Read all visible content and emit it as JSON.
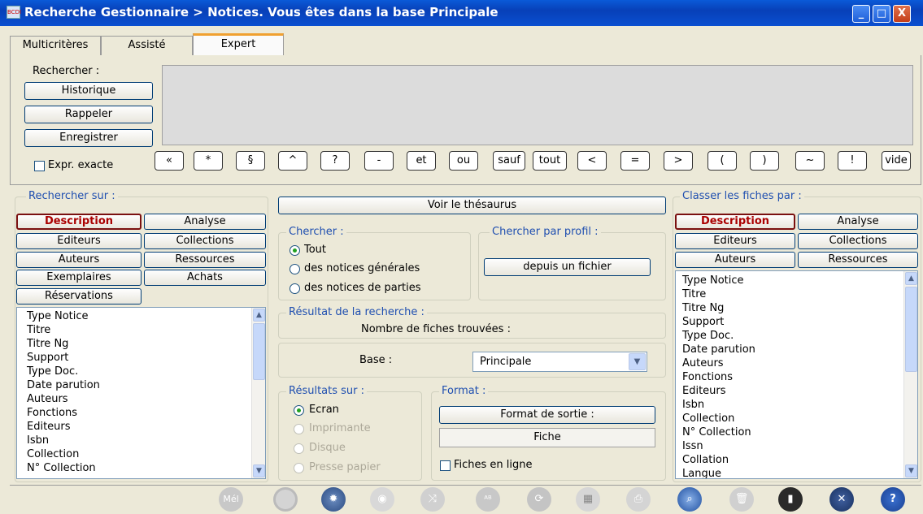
{
  "window": {
    "title": "Recherche Gestionnaire > Notices.  Vous êtes dans la base Principale",
    "icon_text": "BCDI",
    "minimize": "_",
    "maximize": "□",
    "close": "X"
  },
  "tabs": [
    {
      "label": "Multicritères"
    },
    {
      "label": "Assisté"
    },
    {
      "label": "Expert"
    }
  ],
  "expert": {
    "rechercher_label": "Rechercher :",
    "historique": "Historique",
    "rappeler": "Rappeler",
    "enregistrer": "Enregistrer",
    "expr_exacte": "Expr. exacte",
    "query_value": "",
    "symbols": [
      "«",
      "*",
      "§",
      "^",
      "?",
      "-",
      "et",
      "ou",
      "sauf",
      "tout",
      "<",
      "=",
      ">",
      "(",
      ")",
      "~",
      "!",
      "vide"
    ]
  },
  "rechercher_sur": {
    "label": "Rechercher sur :",
    "buttons": [
      "Description",
      "Analyse",
      "Editeurs",
      "Collections",
      "Auteurs",
      "Ressources",
      "Exemplaires",
      "Achats",
      "Réservations"
    ],
    "fields": [
      "Type Notice",
      "Titre",
      "Titre Ng",
      "Support",
      "Type Doc.",
      "Date parution",
      "Auteurs",
      "Fonctions",
      "Editeurs",
      "Isbn",
      "Collection",
      "N° Collection"
    ]
  },
  "center": {
    "voir_thesaurus": "Voir le thésaurus",
    "chercher_label": "Chercher :",
    "chercher_options": [
      "Tout",
      "des notices générales",
      "des notices de parties"
    ],
    "profil_label": "Chercher par profil :",
    "depuis_fichier": "depuis un fichier",
    "resultat_label": "Résultat de la recherche :",
    "nombre_fiches": "Nombre de fiches trouvées :",
    "base_label": "Base :",
    "base_value": "Principale",
    "resultats_sur_label": "Résultats sur :",
    "resultats_options": [
      "Ecran",
      "Imprimante",
      "Disque",
      "Presse papier"
    ],
    "format_label": "Format :",
    "format_sortie": "Format de sortie :",
    "format_value": "Fiche",
    "fiches_en_ligne": "Fiches en ligne"
  },
  "classer": {
    "label": "Classer les fiches par :",
    "buttons": [
      "Description",
      "Analyse",
      "Editeurs",
      "Collections",
      "Auteurs",
      "Ressources"
    ],
    "fields": [
      "Type Notice",
      "Titre",
      "Titre Ng",
      "Support",
      "Type Doc.",
      "Date parution",
      "Auteurs",
      "Fonctions",
      "Editeurs",
      "Isbn",
      "Collection",
      "N° Collection",
      "Issn",
      "Collation",
      "Langue"
    ]
  },
  "toolbar": {
    "mel": "Mél",
    "icons": [
      "mail-icon",
      "refresh-disabled-icon",
      "settings-gear-icon",
      "preview-eye-icon",
      "shuffle-icon",
      "spellcheck-icon",
      "reload-icon",
      "grid-icon",
      "print-icon",
      "search-globe-icon",
      "trash-icon",
      "note-icon",
      "close-x-icon",
      "help-icon"
    ]
  },
  "colors": {
    "title_blue": "#0840b8",
    "group_label": "#1f4fb0",
    "selected_red": "#a00000",
    "panel_bg": "#ece9d8"
  }
}
